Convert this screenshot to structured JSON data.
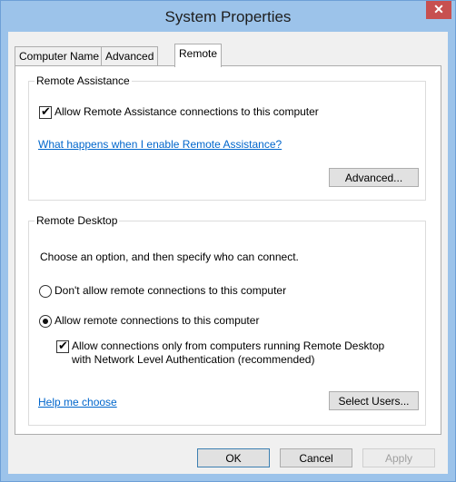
{
  "window": {
    "title": "System Properties"
  },
  "tabs": [
    {
      "label": "Computer Name"
    },
    {
      "label": "Advanced"
    },
    {
      "label": "Remote"
    }
  ],
  "remote_assistance": {
    "title": "Remote Assistance",
    "checkbox_label": "Allow Remote Assistance connections to this computer",
    "checked": true,
    "help_link": "What happens when I enable Remote Assistance?",
    "advanced_button": "Advanced..."
  },
  "remote_desktop": {
    "title": "Remote Desktop",
    "instruction": "Choose an option, and then specify who can connect.",
    "option_dont_allow": "Don't allow remote connections to this computer",
    "option_allow": "Allow remote connections to this computer",
    "selected_option": "allow",
    "nla_line1": "Allow connections only from computers running Remote Desktop",
    "nla_line2": "with Network Level Authentication (recommended)",
    "nla_checked": true,
    "help_link": "Help me choose",
    "select_users_button": "Select Users..."
  },
  "buttons": {
    "ok": "OK",
    "cancel": "Cancel",
    "apply": "Apply"
  },
  "colors": {
    "highlight": "#e0231e",
    "link": "#0066cc",
    "title_bar": "#9cc3ea",
    "close": "#c75050"
  }
}
